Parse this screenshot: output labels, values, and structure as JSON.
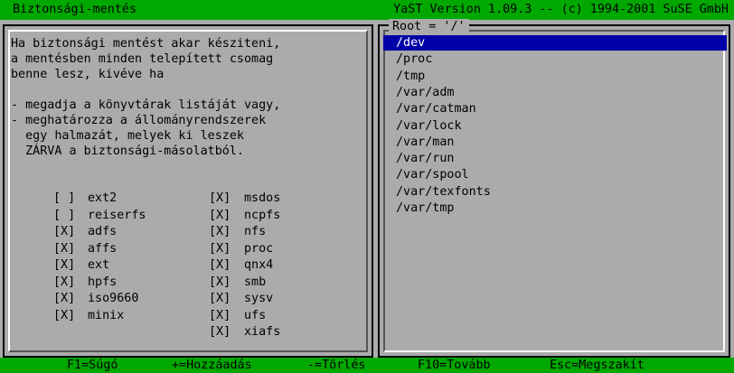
{
  "title": {
    "left": "Biztonsági-mentés",
    "right": "YaST Version 1.09.3 -- (c) 1994-2001 SuSE GmbH"
  },
  "description": [
    "Ha biztonsági mentést akar késziteni,",
    "a mentésben minden telepített csomag",
    "benne lesz, kivéve ha",
    "",
    "- megadja a könyvtárak listáját vagy,",
    "- meghatározza a állományrendszerek",
    "  egy halmazát, melyek ki leszek",
    "  ZÁRVA a biztonsági-másolatból."
  ],
  "filesystems_left": [
    {
      "mark": "[ ]",
      "name": "ext2"
    },
    {
      "mark": "[ ]",
      "name": "reiserfs"
    },
    {
      "mark": "[X]",
      "name": "adfs"
    },
    {
      "mark": "[X]",
      "name": "affs"
    },
    {
      "mark": "[X]",
      "name": "ext"
    },
    {
      "mark": "[X]",
      "name": "hpfs"
    },
    {
      "mark": "[X]",
      "name": "iso9660"
    },
    {
      "mark": "[X]",
      "name": "minix"
    }
  ],
  "filesystems_right": [
    {
      "mark": "[X]",
      "name": "msdos"
    },
    {
      "mark": "[X]",
      "name": "ncpfs"
    },
    {
      "mark": "[X]",
      "name": "nfs"
    },
    {
      "mark": "[X]",
      "name": "proc"
    },
    {
      "mark": "[X]",
      "name": "qnx4"
    },
    {
      "mark": "[X]",
      "name": "smb"
    },
    {
      "mark": "[X]",
      "name": "sysv"
    },
    {
      "mark": "[X]",
      "name": "ufs"
    },
    {
      "mark": "[X]",
      "name": "xiafs"
    }
  ],
  "root_label": "Root = '/'",
  "directories": [
    "/dev",
    "/proc",
    "/tmp",
    "/var/adm",
    "/var/catman",
    "/var/lock",
    "/var/man",
    "/var/run",
    "/var/spool",
    "/var/texfonts",
    "/var/tmp"
  ],
  "selected_directory": "/dev",
  "statusbar": {
    "f1": "F1=Súgó",
    "plus": "+=Hozzáadás",
    "minus": "-=Törlés",
    "f10": "F10=Tovább",
    "esc": "Esc=Megszakít"
  },
  "colors": {
    "background": "#ababab",
    "bar": "#00a800",
    "selection": "#0000a8"
  }
}
